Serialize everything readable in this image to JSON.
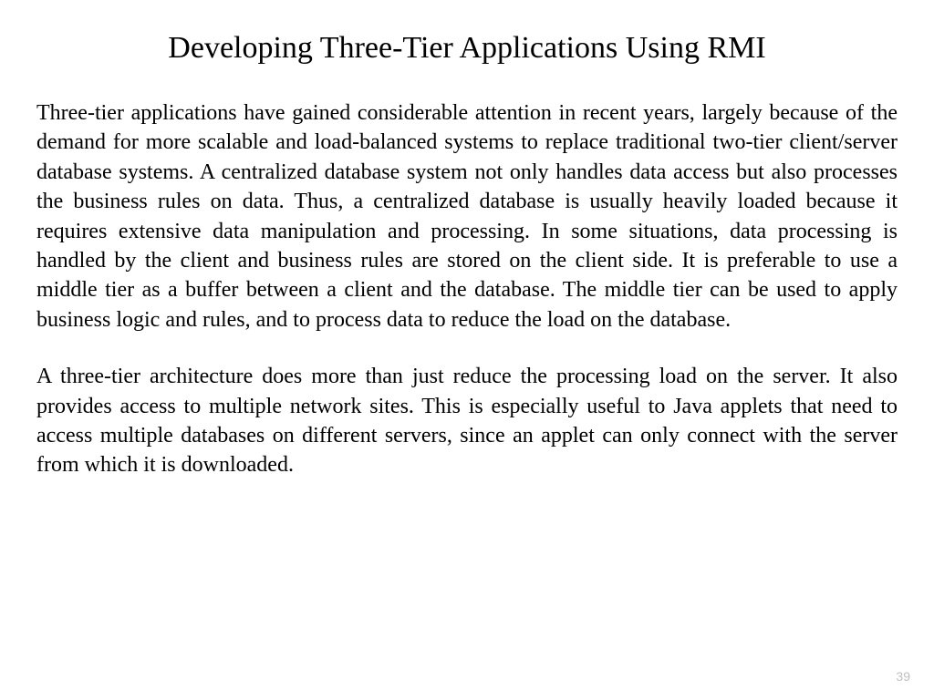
{
  "slide": {
    "title": "Developing Three-Tier Applications Using RMI",
    "paragraph1": "Three-tier applications have gained considerable attention in recent years, largely because of the demand for more scalable and load-balanced systems to replace traditional two-tier client/server database systems. A centralized database system not only handles data access but also processes the business rules on data. Thus, a centralized database is usually heavily loaded because it requires extensive data manipulation and processing. In some situations, data processing is handled by the client and business rules are stored on the client side. It is preferable to use a middle tier as a buffer between a client and the database. The middle tier can be used to apply business logic and rules, and to process data to reduce the load on the database.",
    "paragraph2": "A three-tier architecture does more than just reduce the processing load on the server. It also provides access to multiple network sites. This is especially useful to Java applets that need to access multiple databases on different servers, since an applet can only connect with the server from which it is downloaded.",
    "pageNumber": "39"
  }
}
